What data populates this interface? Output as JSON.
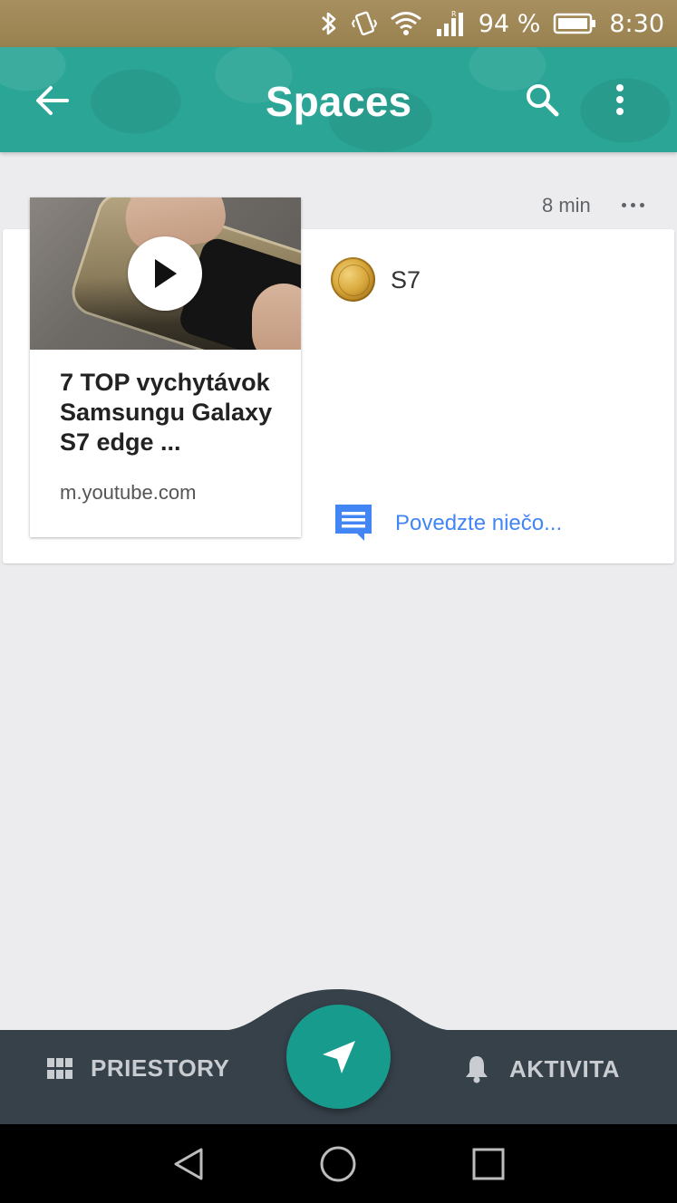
{
  "status_bar": {
    "battery_percent": "94 %",
    "time": "8:30",
    "icons": [
      "bluetooth-icon",
      "vibrate-icon",
      "wifi-icon",
      "signal-icon",
      "battery-icon"
    ]
  },
  "app_bar": {
    "title": "Spaces",
    "icons": [
      "back-arrow-icon",
      "search-icon",
      "more-vert-icon"
    ],
    "accent_color": "#2aa596"
  },
  "post": {
    "timestamp": "8 min",
    "space_name": "S7",
    "link": {
      "title": "7 TOP vychytávok Samsungu Galaxy S7 edge ...",
      "domain": "m.youtube.com",
      "has_video": true
    },
    "comment_placeholder": "Povedzte niečo..."
  },
  "bottom_nav": {
    "left_label": "PRIESTORY",
    "right_label": "AKTIVITA",
    "fab_icon": "send-icon",
    "fab_color": "#179b8c"
  },
  "system_nav": {
    "buttons": [
      "back-triangle-icon",
      "home-circle-icon",
      "recents-square-icon"
    ]
  }
}
